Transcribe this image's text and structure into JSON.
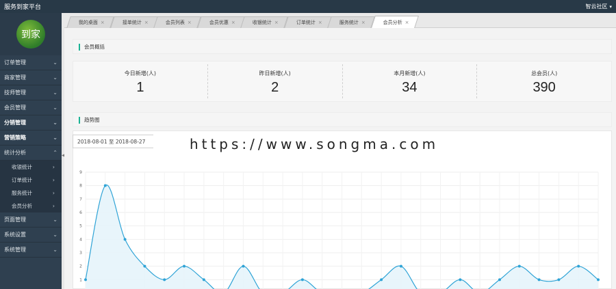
{
  "app": {
    "title": "服务到家平台",
    "user": "智云社区"
  },
  "logo": {
    "text": "到家"
  },
  "sidebar": {
    "items_top": [
      {
        "label": "订单管理"
      },
      {
        "label": "商家管理"
      },
      {
        "label": "技师管理"
      },
      {
        "label": "会员管理"
      },
      {
        "label": "分销管理"
      },
      {
        "label": "营销策略"
      },
      {
        "label": "统计分析"
      }
    ],
    "sub_items": [
      {
        "label": "收银统计"
      },
      {
        "label": "订单统计"
      },
      {
        "label": "服务统计"
      },
      {
        "label": "会员分析"
      }
    ],
    "items_bottom": [
      {
        "label": "页面管理"
      },
      {
        "label": "系统设置"
      },
      {
        "label": "系统管理"
      }
    ]
  },
  "tabs": [
    {
      "label": "我的桌面"
    },
    {
      "label": "接单统计"
    },
    {
      "label": "会员列表"
    },
    {
      "label": "会员优惠"
    },
    {
      "label": "收银统计"
    },
    {
      "label": "订单统计"
    },
    {
      "label": "服务统计"
    },
    {
      "label": "会员分析"
    }
  ],
  "overview": {
    "heading": "会员概括",
    "stats": [
      {
        "label": "今日新增(人)",
        "value": "1"
      },
      {
        "label": "昨日新增(人)",
        "value": "2"
      },
      {
        "label": "本月新增(人)",
        "value": "34"
      },
      {
        "label": "总会员(人)",
        "value": "390"
      }
    ]
  },
  "trend": {
    "heading": "趋势图",
    "date_range": "2018-08-01 至 2018-08-27",
    "watermark": "https://www.songma.com"
  },
  "chart_data": {
    "type": "area",
    "ylim": [
      0,
      9
    ],
    "yticks": [
      "0",
      "1",
      "2",
      "3",
      "4",
      "5",
      "6",
      "7",
      "8",
      "9"
    ],
    "values": [
      1,
      8,
      4,
      2,
      1,
      2,
      1,
      0,
      2,
      0,
      0,
      1,
      0,
      0,
      0,
      1,
      2,
      0,
      0,
      1,
      0,
      1,
      2,
      1,
      1,
      2,
      1
    ],
    "line_color": "#2ea3d6",
    "fill_color": "#e6f4fb"
  }
}
